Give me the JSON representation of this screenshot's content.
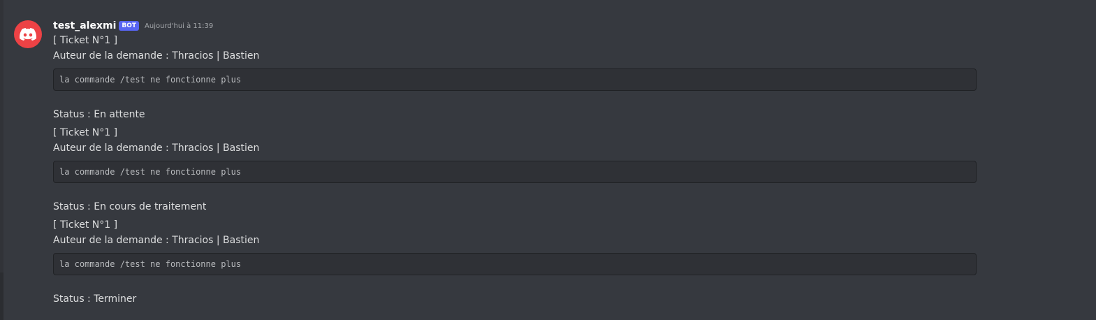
{
  "message": {
    "username": "test_alexmi",
    "badge": "BOT",
    "timestamp": "Aujourd'hui à 11:39",
    "avatar_color": "#ed4245",
    "tickets": [
      {
        "title": "[ Ticket N°1 ]",
        "author": "Auteur de la demande : Thracios | Bastien",
        "code": "la commande /test ne fonctionne plus",
        "status": "Status : En attente"
      },
      {
        "title": "[ Ticket N°1 ]",
        "author": "Auteur de la demande : Thracios | Bastien",
        "code": "la commande /test ne fonctionne plus",
        "status": "Status : En cours de traitement"
      },
      {
        "title": "[ Ticket N°1 ]",
        "author": "Auteur de la demande : Thracios | Bastien",
        "code": "la commande /test ne fonctionne plus",
        "status": "Status : Terminer"
      }
    ]
  }
}
